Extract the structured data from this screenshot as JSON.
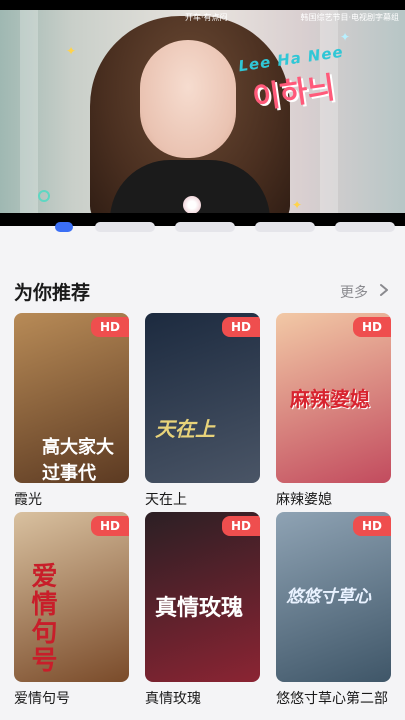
{
  "player": {
    "caption_top": "开车·有点闷",
    "caption_right": "韩国综艺节目·电视剧字幕组",
    "name_en": "Lee Ha Nee",
    "name_ko": "이하늬"
  },
  "section": {
    "title": "为你推荐",
    "more_label": "更多",
    "more_icon": "chevron-right-icon"
  },
  "badge_label": "HD",
  "items": [
    {
      "title": "霞光",
      "poster_text": "高大家大过事代",
      "colors": [
        "#b88b57",
        "#5c3a22"
      ]
    },
    {
      "title": "天在上",
      "poster_text": "天在上",
      "colors": [
        "#1c2a3f",
        "#4a5566"
      ]
    },
    {
      "title": "麻辣婆媳",
      "poster_text": "麻辣婆媳",
      "colors": [
        "#f2c9a6",
        "#c24b5e"
      ]
    },
    {
      "title": "爱情句号",
      "poster_text": "爱情句号",
      "colors": [
        "#d9c1a0",
        "#7a4b2a"
      ]
    },
    {
      "title": "真情玫瑰",
      "poster_text": "真情玫瑰",
      "colors": [
        "#2b1f24",
        "#8b2433"
      ]
    },
    {
      "title": "悠悠寸草心第二部",
      "poster_text": "悠悠寸草心",
      "colors": [
        "#8fa3b4",
        "#3f5668"
      ]
    }
  ]
}
